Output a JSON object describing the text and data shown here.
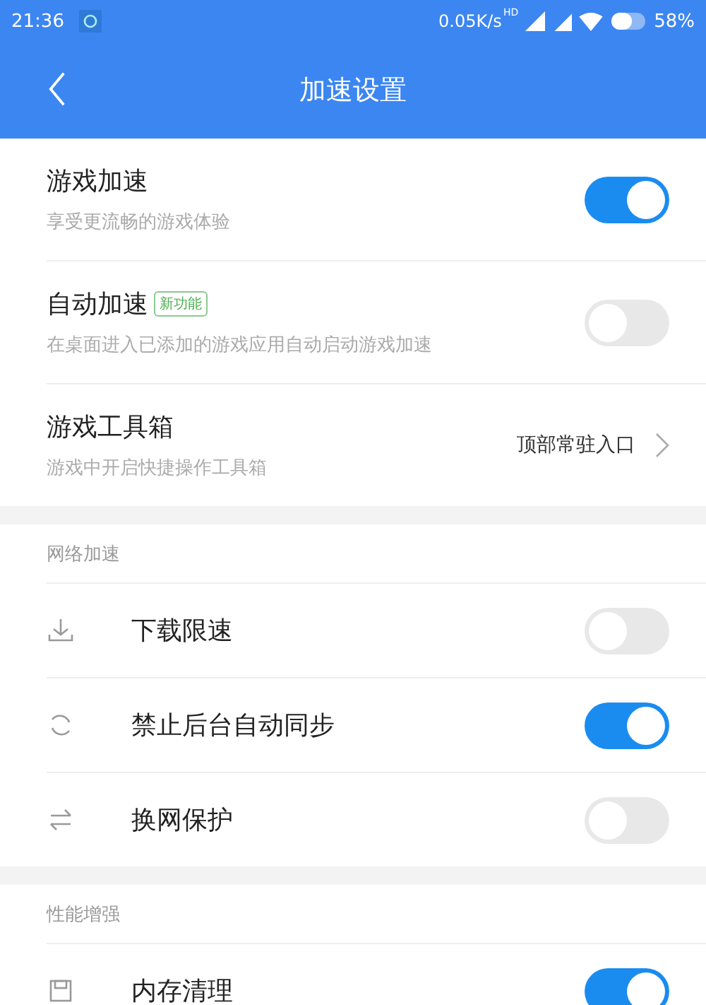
{
  "status_bar": {
    "time": "21:36",
    "speed": "0.05K/s",
    "hd": "HD",
    "battery": "58%"
  },
  "header": {
    "title": "加速设置"
  },
  "sections": [
    {
      "items": [
        {
          "kind": "toggle",
          "title": "游戏加速",
          "subtitle": "享受更流畅的游戏体验",
          "on": true
        },
        {
          "kind": "toggle",
          "title": "自动加速",
          "badge": "新功能",
          "subtitle": "在桌面进入已添加的游戏应用自动启动游戏加速",
          "on": false
        },
        {
          "kind": "link",
          "title": "游戏工具箱",
          "subtitle": "游戏中开启快捷操作工具箱",
          "value": "顶部常驻入口"
        }
      ]
    },
    {
      "heading": "网络加速",
      "items": [
        {
          "kind": "toggle",
          "title": "下载限速",
          "on": false
        },
        {
          "kind": "toggle",
          "title": "禁止后台自动同步",
          "on": true
        },
        {
          "kind": "toggle",
          "title": "换网保护",
          "on": false
        }
      ]
    },
    {
      "heading": "性能增强",
      "items": [
        {
          "kind": "toggle",
          "title": "内存清理",
          "on": true
        }
      ]
    }
  ]
}
